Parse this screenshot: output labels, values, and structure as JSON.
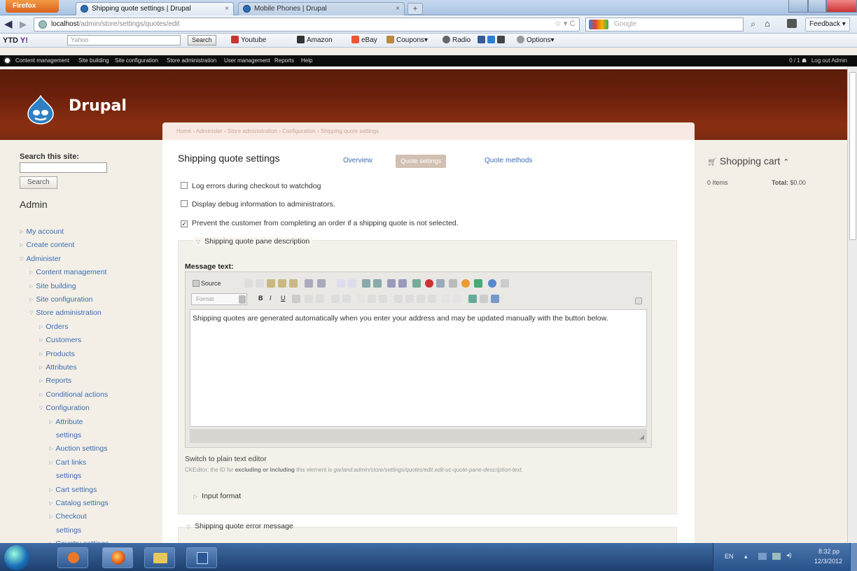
{
  "browser": {
    "app_button": "Firefox",
    "tabs": [
      {
        "label": "Shipping quote settings | Drupal",
        "close": "×"
      },
      {
        "label": "Mobile Phones | Drupal",
        "close": "×"
      }
    ],
    "new_tab": "+",
    "url_host": "localhost",
    "url_path": "/admin/store/settings/quotes/edit",
    "url_right": "☆ ▾ C",
    "search_placeholder": "Google",
    "feedback": "Feedback ▾"
  },
  "yahoo_toolbar": {
    "brand": "YTD",
    "yahoo": "Y!",
    "yahoo_box": "Yahoo",
    "search_btn": "Search",
    "links": [
      "Youtube",
      "Amazon",
      "eBay",
      "Coupons▾",
      "Radio",
      "Options▾"
    ]
  },
  "admin_menu": {
    "items": [
      "Content management",
      "Site building",
      "Site configuration",
      "Store administration",
      "User management",
      "Reports",
      "Help"
    ],
    "right": "0 / 1",
    "logout": "Log out Admin"
  },
  "site": {
    "name": "Drupal"
  },
  "breadcrumb": "Home › Administer › Store administration › Configuration › Shipping quote settings",
  "sidebar": {
    "search_label": "Search this site:",
    "search_button": "Search",
    "admin_title": "Admin",
    "nav": [
      {
        "label": "My account",
        "lvl": 0
      },
      {
        "label": "Create content",
        "lvl": 0
      },
      {
        "label": "Administer",
        "lvl": 0
      },
      {
        "label": "Content management",
        "lvl": 1
      },
      {
        "label": "Site building",
        "lvl": 1
      },
      {
        "label": "Site configuration",
        "lvl": 1
      },
      {
        "label": "Store administration",
        "lvl": 1
      },
      {
        "label": "Orders",
        "lvl": 2
      },
      {
        "label": "Customers",
        "lvl": 2
      },
      {
        "label": "Products",
        "lvl": 2
      },
      {
        "label": "Attributes",
        "lvl": 2
      },
      {
        "label": "Reports",
        "lvl": 2
      },
      {
        "label": "Conditional actions",
        "lvl": 2
      },
      {
        "label": "Configuration",
        "lvl": 2
      },
      {
        "label": "Attribute",
        "lvl": 3
      },
      {
        "label": "settings",
        "lvl": 3,
        "cont": true
      },
      {
        "label": "Auction settings",
        "lvl": 3
      },
      {
        "label": "Cart links",
        "lvl": 3
      },
      {
        "label": "settings",
        "lvl": 3,
        "cont": true
      },
      {
        "label": "Cart settings",
        "lvl": 3
      },
      {
        "label": "Catalog settings",
        "lvl": 3
      },
      {
        "label": "Checkout",
        "lvl": 3
      },
      {
        "label": "settings",
        "lvl": 3,
        "cont": true
      },
      {
        "label": "Country settings",
        "lvl": 3
      }
    ]
  },
  "main": {
    "title": "Shipping quote settings",
    "tabs": {
      "overview": "Overview",
      "active": "Quote settings",
      "methods": "Quote methods"
    },
    "checkboxes": [
      {
        "label": "Log errors during checkout to watchdog",
        "checked": false
      },
      {
        "label": "Display debug information to administrators.",
        "checked": false
      },
      {
        "label": "Prevent the customer from completing an order if a shipping quote is not selected.",
        "checked": true
      }
    ],
    "fieldset1": "Shipping quote pane description",
    "message_label": "Message text:",
    "editor": {
      "source": "Source",
      "format": "Format",
      "content": "Shipping quotes are generated automatically when you enter your address and may be updated manually with the button below."
    },
    "switch_link": "Switch to plain text editor",
    "ck_desc_prefix": "CKEditor: the ID for ",
    "ck_desc_bold": "excluding or including",
    "ck_desc_mid": " this element is ",
    "ck_desc_id": "garland:admin/store/settings/quotes/edit.edit-uc-quote-pane-description-text",
    "ck_desc_end": ".",
    "input_format": "Input format",
    "fieldset2": "Shipping quote error message"
  },
  "cart": {
    "title": "Shopping cart",
    "items": "0 Items",
    "total_label": "Total:",
    "total_value": "$0.00"
  },
  "tray": {
    "lang": "EN",
    "time": "8:32 pp",
    "date": "12/3/2012"
  }
}
